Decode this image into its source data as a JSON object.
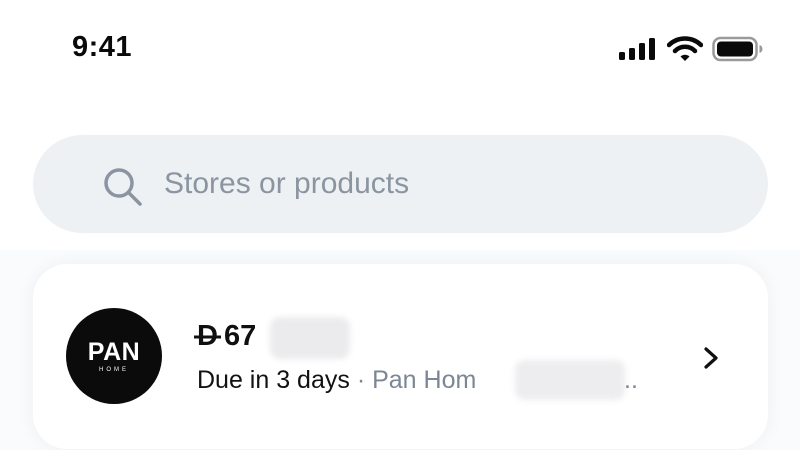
{
  "status_bar": {
    "time": "9:41",
    "icons": [
      "cellular-signal-icon",
      "wifi-icon",
      "battery-icon"
    ]
  },
  "search": {
    "placeholder": "Stores or products",
    "icon": "search-icon"
  },
  "payment_card": {
    "logo_text": "PAN",
    "logo_subtext": "HOME",
    "currency_symbol": "D",
    "amount_visible": "67",
    "due_text": "Due in 3 days",
    "separator": " · ",
    "store_name_visible": "Pan Hom",
    "ellipsis": "..",
    "chevron_icon": "chevron-right-icon"
  },
  "colors": {
    "background": "#fafbfc",
    "search_background": "#eef1f4",
    "placeholder": "#8a95a1",
    "secondary_text": "#7b8794",
    "logo_background": "#0b0b0b"
  }
}
